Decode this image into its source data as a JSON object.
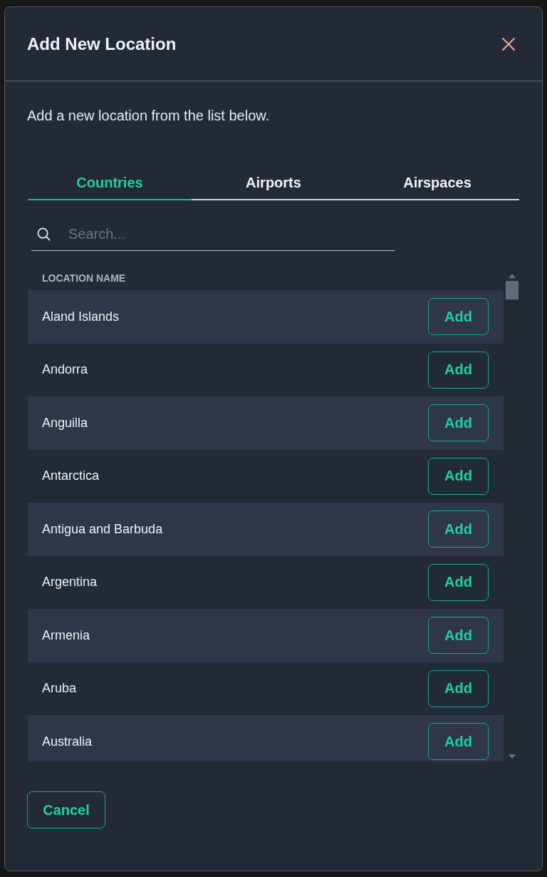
{
  "dialog": {
    "title": "Add New Location",
    "description": "Add a new location from the list below."
  },
  "tabs": [
    {
      "label": "Countries",
      "selected": true
    },
    {
      "label": "Airports",
      "selected": false
    },
    {
      "label": "Airspaces",
      "selected": false
    }
  ],
  "search": {
    "placeholder": "Search..."
  },
  "table": {
    "columns": [
      "LOCATION NAME"
    ],
    "rows": [
      {
        "name": "Aland Islands",
        "action": "Add"
      },
      {
        "name": "Andorra",
        "action": "Add"
      },
      {
        "name": "Anguilla",
        "action": "Add"
      },
      {
        "name": "Antarctica",
        "action": "Add"
      },
      {
        "name": "Antigua and Barbuda",
        "action": "Add"
      },
      {
        "name": "Argentina",
        "action": "Add"
      },
      {
        "name": "Armenia",
        "action": "Add"
      },
      {
        "name": "Aruba",
        "action": "Add"
      },
      {
        "name": "Australia",
        "action": "Add"
      }
    ]
  },
  "footer": {
    "cancel": "Cancel"
  }
}
